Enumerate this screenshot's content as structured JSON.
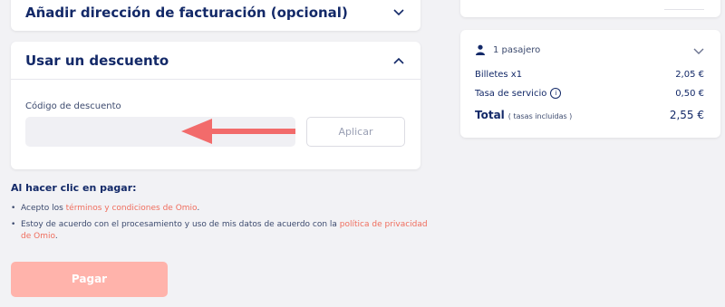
{
  "billing": {
    "title": "Añadir dirección de facturación (opcional)"
  },
  "discount": {
    "title": "Usar un descuento",
    "field_label": "Código de descuento",
    "input_value": "",
    "apply_label": "Aplicar"
  },
  "terms": {
    "title": "Al hacer clic en pagar:",
    "items": [
      {
        "prefix": "Acepto los ",
        "link": "términos y condiciones de Omio",
        "suffix": "."
      },
      {
        "prefix": "Estoy de acuerdo con el procesamiento y uso de mis datos de acuerdo con la ",
        "link": "política de privacidad de Omio",
        "suffix": "."
      }
    ]
  },
  "pay": {
    "label": "Pagar"
  },
  "summary": {
    "passengers": "1 pasajero",
    "tickets_label": "Billetes x1",
    "tickets_value": "2,05 €",
    "service_label": "Tasa de servicio",
    "service_value": "0,50 €",
    "total_label": "Total",
    "total_sub": "( tasas incluidas )",
    "total_value": "2,55 €"
  },
  "colors": {
    "accent": "#f06e5e",
    "navy": "#132968",
    "pay_button": "#ffb3ab",
    "arrow": "#f26b6b"
  },
  "icons": [
    "chevron-down-icon",
    "chevron-up-icon",
    "person-icon",
    "info-icon",
    "red-arrow-left"
  ]
}
